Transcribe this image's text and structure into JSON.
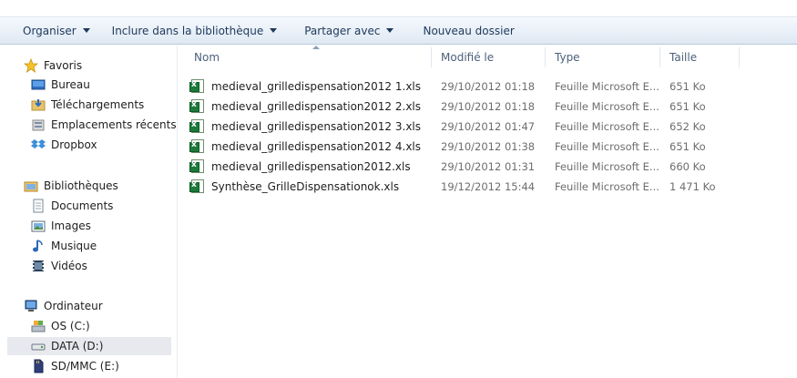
{
  "toolbar": {
    "organize": "Organiser",
    "include_library": "Inclure dans la bibliothèque",
    "share": "Partager avec",
    "new_folder": "Nouveau dossier"
  },
  "nav": {
    "favorites": {
      "label": "Favoris",
      "items": [
        "Bureau",
        "Téléchargements",
        "Emplacements récents",
        "Dropbox"
      ]
    },
    "libraries": {
      "label": "Bibliothèques",
      "items": [
        "Documents",
        "Images",
        "Musique",
        "Vidéos"
      ]
    },
    "computer": {
      "label": "Ordinateur",
      "items": [
        "OS (C:)",
        "DATA (D:)",
        "SD/MMC (E:)"
      ],
      "selected": "DATA (D:)"
    }
  },
  "columns": {
    "name": "Nom",
    "modified": "Modifié le",
    "type": "Type",
    "size": "Taille"
  },
  "files": [
    {
      "name": "medieval_grilledispensation2012 1.xls",
      "modified": "29/10/2012 01:18",
      "type": "Feuille Microsoft E...",
      "size": "651 Ko"
    },
    {
      "name": "medieval_grilledispensation2012 2.xls",
      "modified": "29/10/2012 01:18",
      "type": "Feuille Microsoft E...",
      "size": "651 Ko"
    },
    {
      "name": "medieval_grilledispensation2012 3.xls",
      "modified": "29/10/2012 01:47",
      "type": "Feuille Microsoft E...",
      "size": "652 Ko"
    },
    {
      "name": "medieval_grilledispensation2012 4.xls",
      "modified": "29/10/2012 01:38",
      "type": "Feuille Microsoft E...",
      "size": "651 Ko"
    },
    {
      "name": "medieval_grilledispensation2012.xls",
      "modified": "29/10/2012 01:31",
      "type": "Feuille Microsoft E...",
      "size": "660 Ko"
    },
    {
      "name": "Synthèse_GrilleDispensationok.xls",
      "modified": "19/12/2012 15:44",
      "type": "Feuille Microsoft E...",
      "size": "1 471 Ko"
    }
  ],
  "colors": {
    "toolbar_text": "#1e395b",
    "selected_bg": "#e7e9ee",
    "header_text": "#4c607a"
  }
}
